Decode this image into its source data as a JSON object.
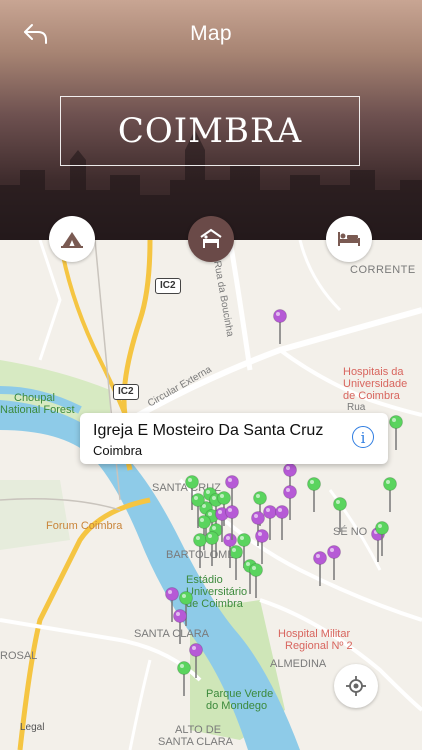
{
  "header": {
    "title": "Map",
    "city": "COIMBRA"
  },
  "categories": [
    {
      "name": "tent-icon",
      "active": false
    },
    {
      "name": "hotel-icon",
      "active": true
    },
    {
      "name": "bed-icon",
      "active": false
    }
  ],
  "map_labels": {
    "corrente": "CORRENTE",
    "hospitais": "Hospitais da",
    "universidade": "Universidade",
    "de_coimbra": "de Coimbra",
    "choupal": "Choupal",
    "national_forest": "National Forest",
    "forum": "Forum Coimbra",
    "santa_cruz": "SANTA CRUZ",
    "se_nova": "SÉ NO",
    "bartolomeu": "BARTOLOMEU",
    "estadio1": "Estádio",
    "estadio2": "Universitário",
    "estadio3": "de Coimbra",
    "santa_clara": "SANTA CLARA",
    "hospital_militar1": "Hospital Militar",
    "hospital_militar2": "Regional Nº 2",
    "almedina": "ALMEDINA",
    "parque1": "Parque Verde",
    "parque2": "do Mondego",
    "alto1": "ALTO DE",
    "alto2": "SANTA CLARA",
    "rosal": "ROSAL",
    "circular": "Circular Externa",
    "rua_boucinha": "Rua da Boucinha",
    "rua": "Rua",
    "road_ic2_a": "IC2",
    "road_ic2_b": "IC2"
  },
  "callout": {
    "title": "Igreja E Mosteiro Da Santa Cruz",
    "subtitle": "Coimbra",
    "info_icon": "i"
  },
  "legal": "Legal",
  "colors": {
    "pin_purple": "#b65ad6",
    "pin_green": "#5ad45e",
    "water": "#8ecbe8",
    "park": "#cfe6b8",
    "highway": "#f5c542"
  }
}
